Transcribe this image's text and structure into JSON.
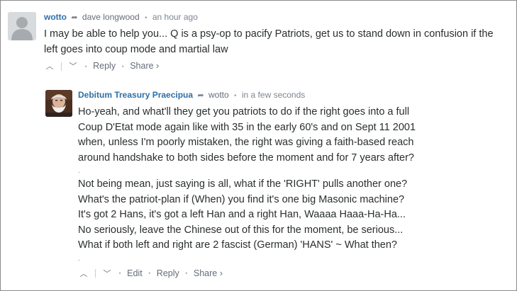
{
  "comment1": {
    "author": "wotto",
    "reply_to": "dave longwood",
    "timestamp": "an hour ago",
    "text_lines": [
      "I may be able to help you... Q is a psy-op to pacify Patriots, get us to stand down in confusion if the",
      "left goes into coup mode and martial law"
    ],
    "actions": {
      "reply": "Reply",
      "share": "Share ›"
    }
  },
  "comment2": {
    "author": "Debitum Treasury Praecipua",
    "reply_to": "wotto",
    "timestamp": "in a few seconds",
    "paragraph1": [
      "Ho-yeah, and what'll they get you patriots to do if the right goes into a full",
      "Coup D'Etat mode again like with 35 in the early 60's and on Sept 11 2001",
      "when, unless I'm poorly mistaken, the right was giving a faith-based reach",
      "around handshake to both sides before the moment and for 7 years after?"
    ],
    "separator": ".",
    "paragraph2": [
      "Not being mean, just saying is all, what if the 'RIGHT' pulls another one?",
      "What's the patriot-plan if (When) you find it's one big Masonic machine?",
      "It's got 2 Hans, it's got a left Han and a right Han, Waaaa Haaa-Ha-Ha...",
      "No seriously, leave the Chinese out of this for the moment, be serious...",
      "What if both left and right are 2 fascist (German) 'HANS' ~ What then?"
    ],
    "actions": {
      "edit": "Edit",
      "reply": "Reply",
      "share": "Share ›"
    }
  },
  "icons": {
    "upvote": "chevron-up-icon",
    "downvote": "chevron-down-icon",
    "reply_arrow": "reply-arrow-icon"
  },
  "colors": {
    "author": "#2e6fa7",
    "meta": "#656c7a",
    "text": "#2a2e2e"
  }
}
